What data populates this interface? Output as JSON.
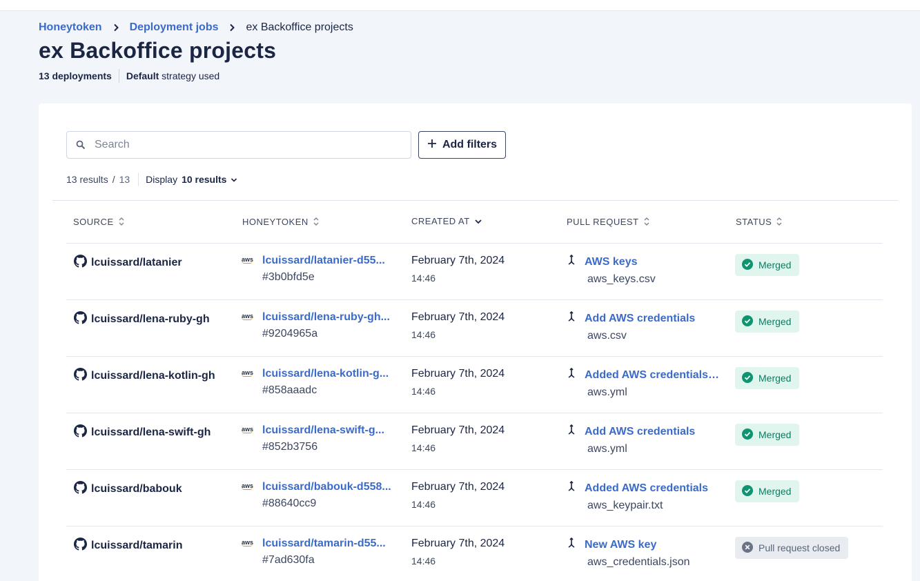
{
  "breadcrumb": {
    "items": [
      "Honeytoken",
      "Deployment jobs"
    ],
    "current": "ex Backoffice projects"
  },
  "page": {
    "title": "ex Backoffice projects",
    "deployments_count": "13 deployments",
    "strategy_name": "Default",
    "strategy_suffix": "strategy used"
  },
  "search": {
    "placeholder": "Search"
  },
  "filters": {
    "add_label": "Add filters"
  },
  "results": {
    "count": "13 results",
    "slash": "/",
    "total": "13",
    "display_label": "Display",
    "display_value": "10 results"
  },
  "columns": {
    "source": "SOURCE",
    "honeytoken": "HONEYTOKEN",
    "created_at": "CREATED AT",
    "pull_request": "PULL REQUEST",
    "status": "STATUS"
  },
  "icons": {
    "search": "search-icon",
    "plus": "plus-icon",
    "chevron": "chevron-down-icon",
    "sort": "sort-icon",
    "github": "github-icon",
    "aws": "aws-icon",
    "pr": "pull-request-icon",
    "merged": "check-circle-icon",
    "closed": "x-circle-icon"
  },
  "colors": {
    "link": "#3a6bc9",
    "merged_bg": "#dff5ee",
    "merged_fg": "#0e7a5f",
    "closed_bg": "#e8ebf0",
    "closed_fg": "#5b6478"
  },
  "rows": [
    {
      "source": "lcuissard/latanier",
      "honeytoken": "lcuissard/latanier-d55...",
      "honeytoken_id": "#3b0bfd5e",
      "date": "February 7th, 2024",
      "time": "14:46",
      "pr_title": "AWS keys",
      "pr_file": "aws_keys.csv",
      "status": "Merged",
      "status_type": "merged"
    },
    {
      "source": "lcuissard/lena-ruby-gh",
      "honeytoken": "lcuissard/lena-ruby-gh...",
      "honeytoken_id": "#9204965a",
      "date": "February 7th, 2024",
      "time": "14:46",
      "pr_title": "Add AWS credentials",
      "pr_file": "aws.csv",
      "status": "Merged",
      "status_type": "merged"
    },
    {
      "source": "lcuissard/lena-kotlin-gh",
      "honeytoken": "lcuissard/lena-kotlin-g...",
      "honeytoken_id": "#858aaadc",
      "date": "February 7th, 2024",
      "time": "14:46",
      "pr_title": "Added AWS credentials ...",
      "pr_file": "aws.yml",
      "status": "Merged",
      "status_type": "merged"
    },
    {
      "source": "lcuissard/lena-swift-gh",
      "honeytoken": "lcuissard/lena-swift-g...",
      "honeytoken_id": "#852b3756",
      "date": "February 7th, 2024",
      "time": "14:46",
      "pr_title": "Add AWS credentials",
      "pr_file": "aws.yml",
      "status": "Merged",
      "status_type": "merged"
    },
    {
      "source": "lcuissard/babouk",
      "honeytoken": "lcuissard/babouk-d558...",
      "honeytoken_id": "#88640cc9",
      "date": "February 7th, 2024",
      "time": "14:46",
      "pr_title": "Added AWS credentials",
      "pr_file": "aws_keypair.txt",
      "status": "Merged",
      "status_type": "merged"
    },
    {
      "source": "lcuissard/tamarin",
      "honeytoken": "lcuissard/tamarin-d55...",
      "honeytoken_id": "#7ad630fa",
      "date": "February 7th, 2024",
      "time": "14:46",
      "pr_title": "New AWS key",
      "pr_file": "aws_credentials.json",
      "status": "Pull request closed",
      "status_type": "closed"
    }
  ]
}
